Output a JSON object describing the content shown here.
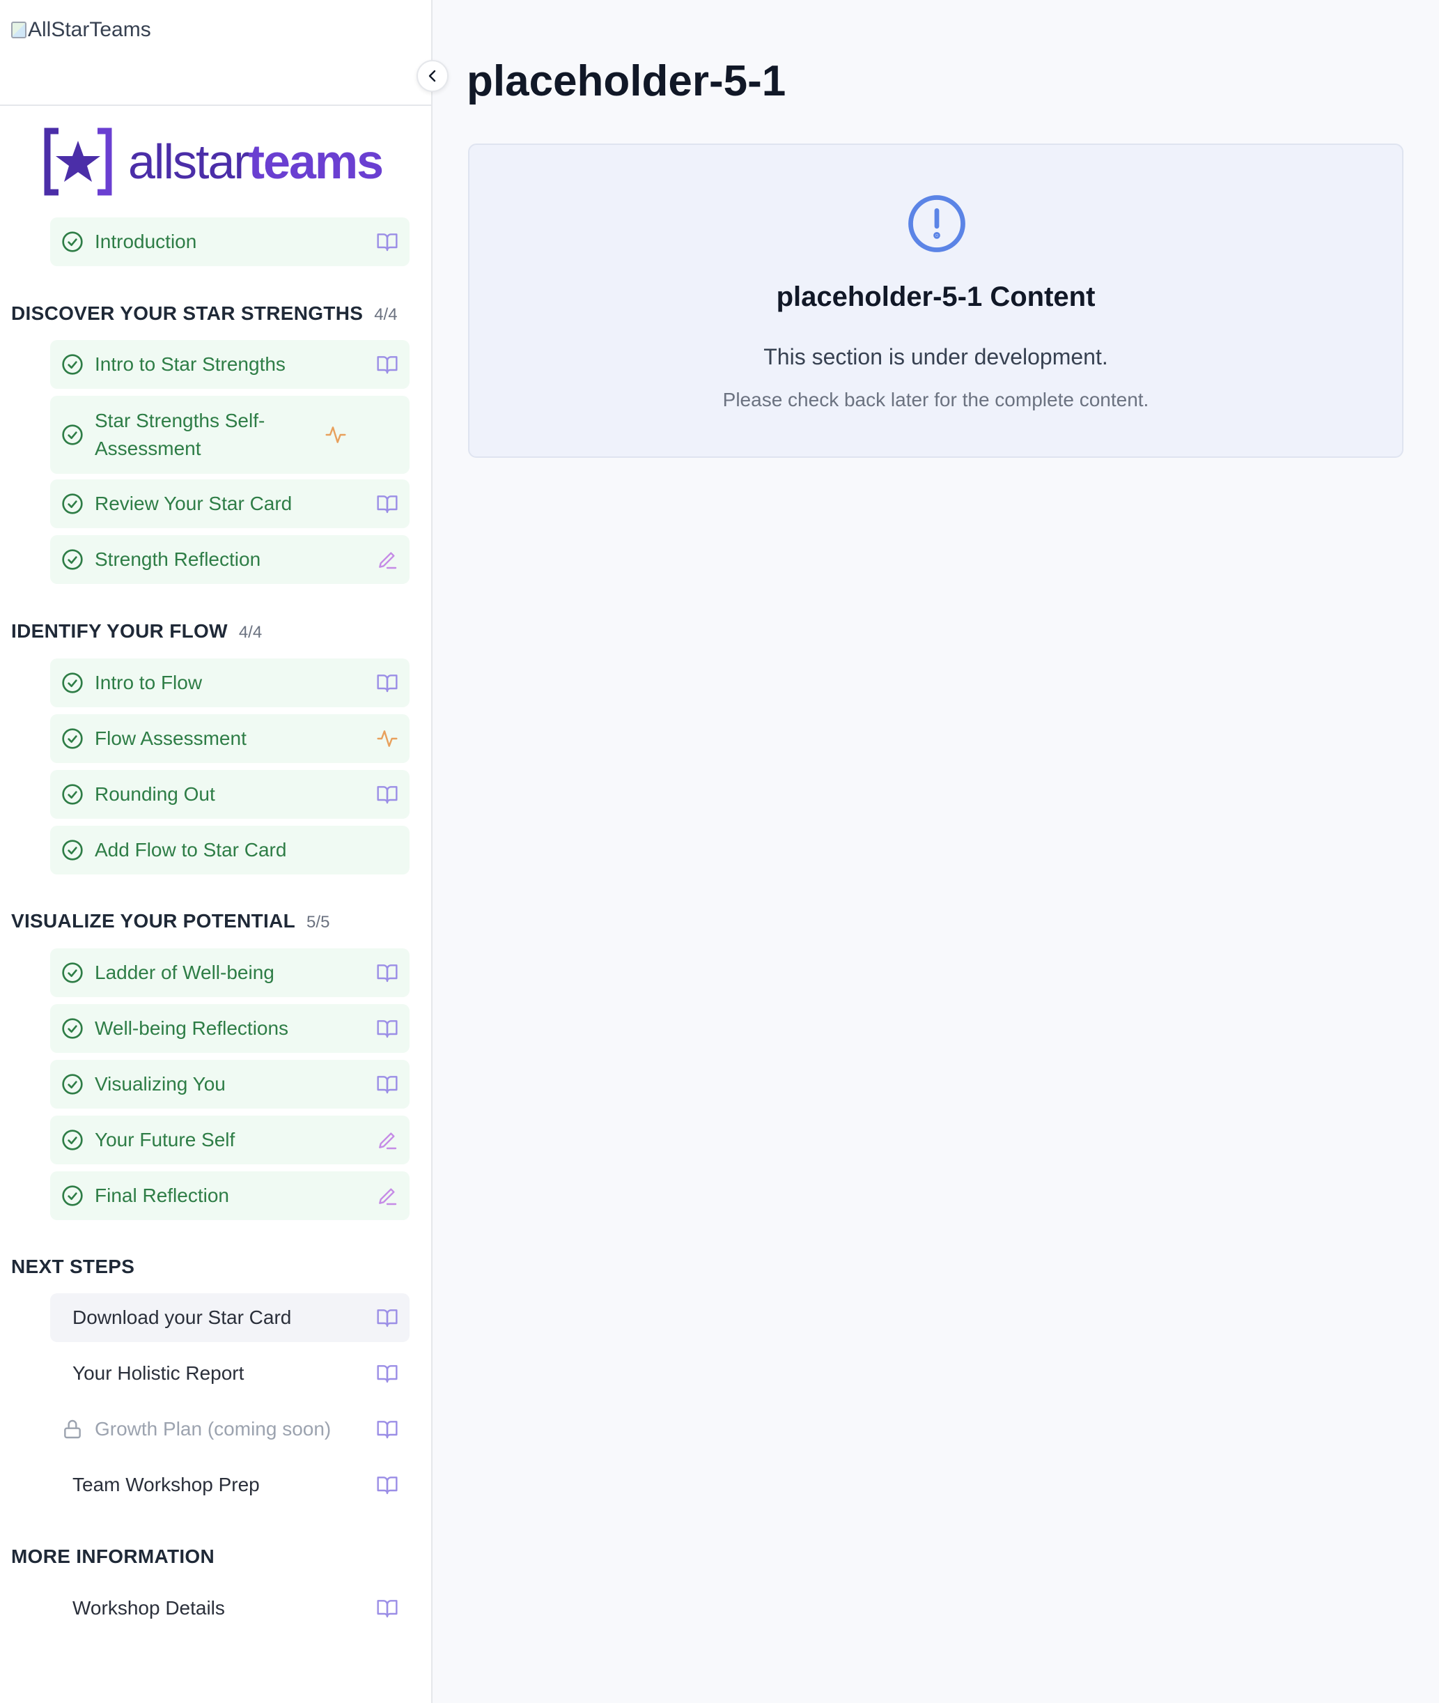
{
  "header": {
    "broken_image_alt": "AllStarTeams",
    "logo_text_all": "allstar",
    "logo_text_teams": "teams"
  },
  "sidebar": {
    "intro": {
      "label": "Introduction",
      "status": "completed",
      "icon": "book-icon"
    },
    "sections": [
      {
        "title": "DISCOVER YOUR STAR STRENGTHS",
        "count": "4/4",
        "items": [
          {
            "label": "Intro to Star Strengths",
            "icon": "book-icon"
          },
          {
            "label": "Star Strengths Self-Assessment",
            "icon": "activity-icon"
          },
          {
            "label": "Review Your Star Card",
            "icon": "book-icon"
          },
          {
            "label": "Strength Reflection",
            "icon": "pencil-icon"
          }
        ]
      },
      {
        "title": "IDENTIFY YOUR FLOW",
        "count": "4/4",
        "items": [
          {
            "label": "Intro to Flow",
            "icon": "book-icon"
          },
          {
            "label": "Flow Assessment",
            "icon": "activity-icon"
          },
          {
            "label": "Rounding Out",
            "icon": "book-icon"
          },
          {
            "label": "Add Flow to Star Card",
            "icon": ""
          }
        ]
      },
      {
        "title": "VISUALIZE YOUR POTENTIAL",
        "count": "5/5",
        "items": [
          {
            "label": "Ladder of Well-being",
            "icon": "book-icon"
          },
          {
            "label": "Well-being Reflections",
            "icon": "book-icon"
          },
          {
            "label": "Visualizing You",
            "icon": "book-icon"
          },
          {
            "label": "Your Future Self",
            "icon": "pencil-icon"
          },
          {
            "label": "Final Reflection",
            "icon": "pencil-icon"
          }
        ]
      },
      {
        "title": "NEXT STEPS",
        "items": [
          {
            "label": "Download your Star Card",
            "icon": "book-icon"
          },
          {
            "label": "Your Holistic Report",
            "icon": "book-icon"
          },
          {
            "label": "Growth Plan (coming soon)",
            "icon": "book-icon"
          },
          {
            "label": "Team Workshop Prep",
            "icon": "book-icon"
          }
        ]
      },
      {
        "title": "MORE INFORMATION",
        "items": [
          {
            "label": "Workshop Details",
            "icon": "book-icon"
          }
        ]
      }
    ]
  },
  "main": {
    "page_title": "placeholder-5-1",
    "card": {
      "title": "placeholder-5-1 Content",
      "message": "This section is under development.",
      "note": "Please check back later for the complete content."
    }
  },
  "colors": {
    "completed_text": "#2e7d46",
    "completed_bg": "#f0faf3",
    "book_icon": "#9b8ee6",
    "activity_icon": "#e8a05c",
    "pencil_icon": "#c58be6",
    "alert_icon": "#5b84e6"
  }
}
